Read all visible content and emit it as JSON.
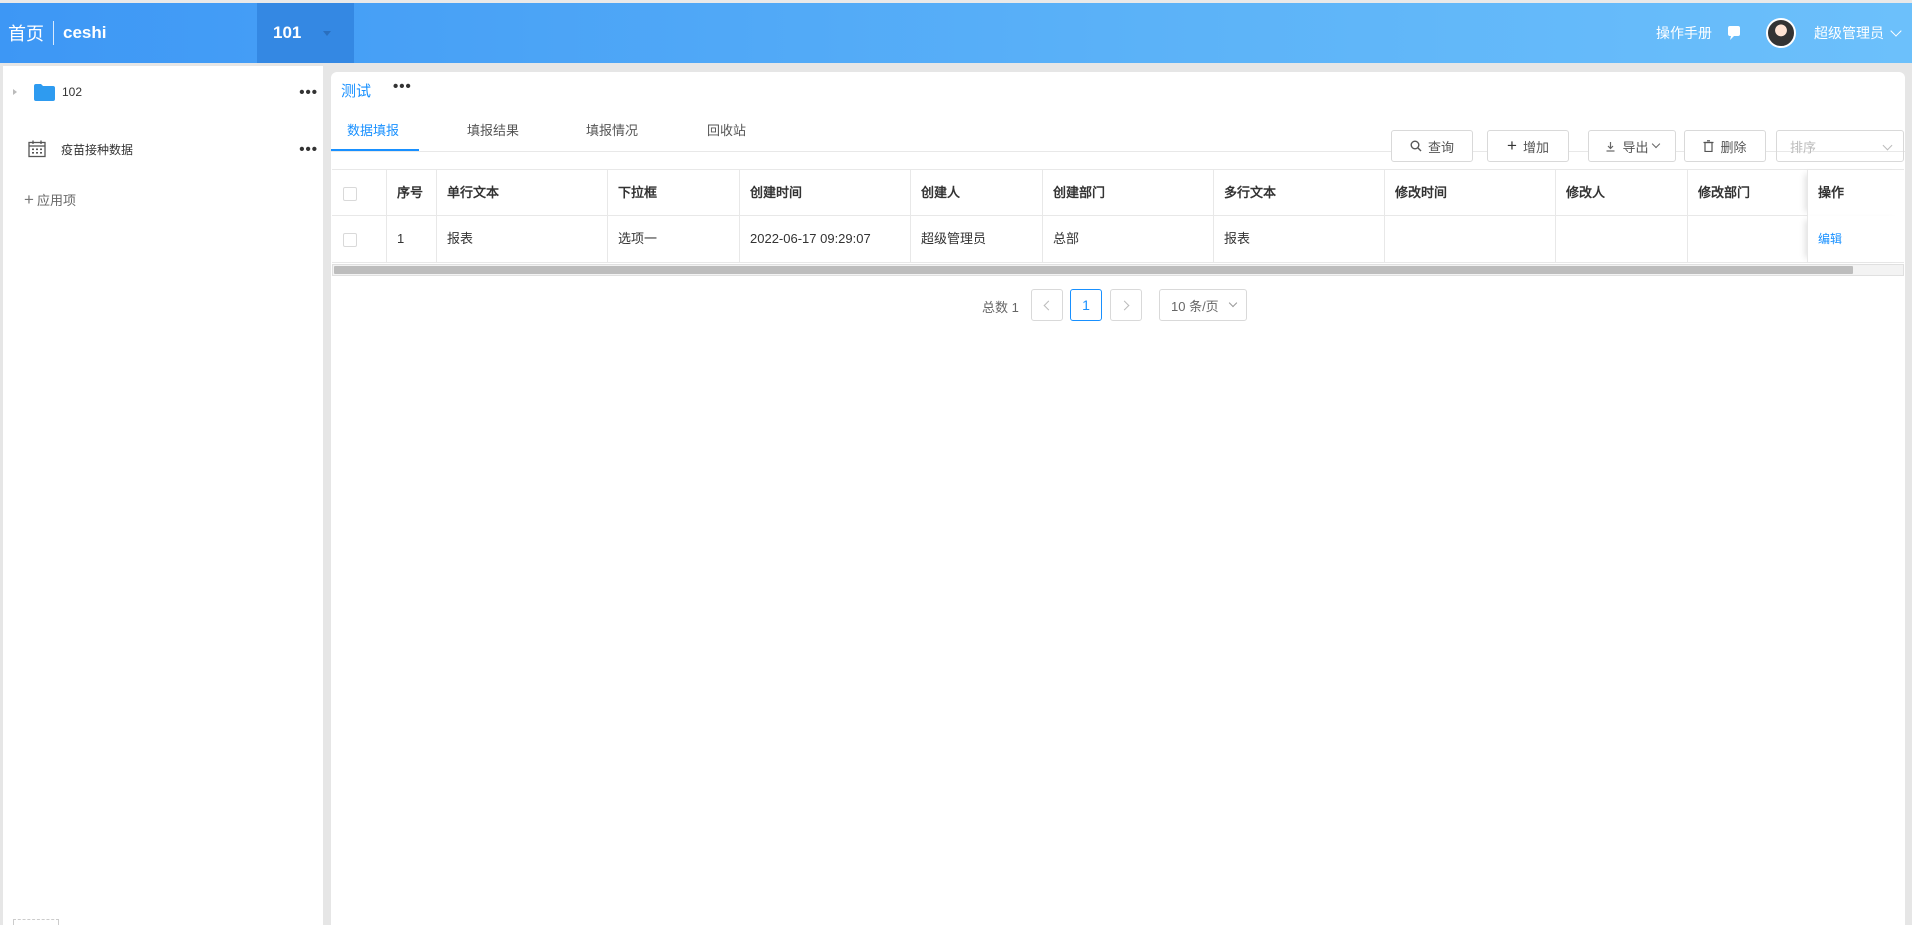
{
  "header": {
    "home_label": "首页",
    "project_name": "ceshi",
    "app_switch_label": "101",
    "manual_label": "操作手册",
    "user_name": "超级管理员"
  },
  "sidebar": {
    "items": [
      {
        "label": "102",
        "icon": "folder-icon"
      },
      {
        "label": "疫苗接种数据",
        "icon": "calendar-icon"
      }
    ],
    "more_glyph": "•••",
    "add_app_label": "应用项"
  },
  "form": {
    "title": "测试",
    "more_glyph": "•••",
    "tabs": [
      "数据填报",
      "填报结果",
      "填报情况",
      "回收站"
    ],
    "active_tab": 0
  },
  "toolbar": {
    "query_label": "查询",
    "add_label": "增加",
    "export_label": "导出",
    "delete_label": "删除",
    "sort_placeholder": "排序"
  },
  "table": {
    "columns": [
      "序号",
      "单行文本",
      "下拉框",
      "创建时间",
      "创建人",
      "创建部门",
      "多行文本",
      "修改时间",
      "修改人",
      "修改部门",
      "操作"
    ],
    "rows": [
      {
        "index": "1",
        "single_text": "报表",
        "dropdown": "选项一",
        "created_time": "2022-06-17 09:29:07",
        "creator": "超级管理员",
        "created_dept": "总部",
        "multi_text": "报表",
        "modified_time": "",
        "modifier": "",
        "modified_dept": "",
        "action_label": "编辑"
      }
    ]
  },
  "pagination": {
    "total_label": "总数 1",
    "current_page": "1",
    "page_size_label": "10 条/页"
  },
  "colors": {
    "primary": "#1890ff",
    "header_start": "#3d97f5",
    "header_end": "#6cc0fb",
    "app_switch_bg": "#3488e3"
  }
}
